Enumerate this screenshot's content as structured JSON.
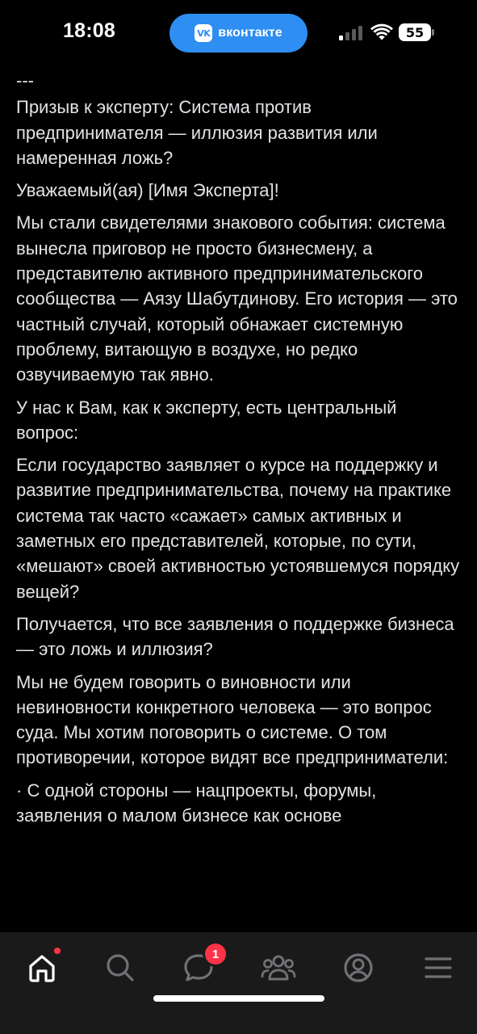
{
  "status_bar": {
    "time": "18:08",
    "app_pill_label": "вконтакте",
    "app_pill_logo": "vk",
    "battery_level": "55"
  },
  "post": {
    "paragraphs": [
      "---",
      "Призыв к эксперту: Система против предпринимателя — иллюзия развития или намеренная ложь?",
      "Уважаемый(ая) [Имя Эксперта]!",
      "Мы стали свидетелями знакового события: система вынесла приговор не просто бизнесмену, а представителю активного предпринимательского сообщества — Аязу Шабутдинову. Его история — это частный случай, который обнажает системную проблему, витающую в воздухе, но редко озвучиваемую так явно.",
      "У нас к Вам, как к эксперту, есть центральный вопрос:",
      "Если государство заявляет о курсе на поддержку и развитие предпринимательства, почему на практике система так часто «сажает» самых активных и заметных его представителей, которые, по сути, «мешают» своей активностью устоявшемуся порядку вещей?",
      "Получается, что все заявления о поддержке бизнеса — это ложь и иллюзия?",
      "Мы не будем говорить о виновности или невиновности конкретного человека — это вопрос суда. Мы хотим поговорить о системе. О том противоречии, которое видят все предприниматели:",
      "· С одной стороны — нацпроекты, форумы, заявления о малом бизнесе как основе"
    ]
  },
  "tabbar": {
    "tabs": [
      "home-icon",
      "search-icon",
      "messages-icon",
      "friends-icon",
      "profile-icon",
      "menu-icon"
    ],
    "messages_badge": "1",
    "home_has_dot": true
  },
  "colors": {
    "background": "#000000",
    "text": "#e1e3e6",
    "accent": "#2e8ef2",
    "badge": "#ff3347",
    "tabbar_bg": "#1a1a1a",
    "icon_inactive": "#6f7175"
  }
}
